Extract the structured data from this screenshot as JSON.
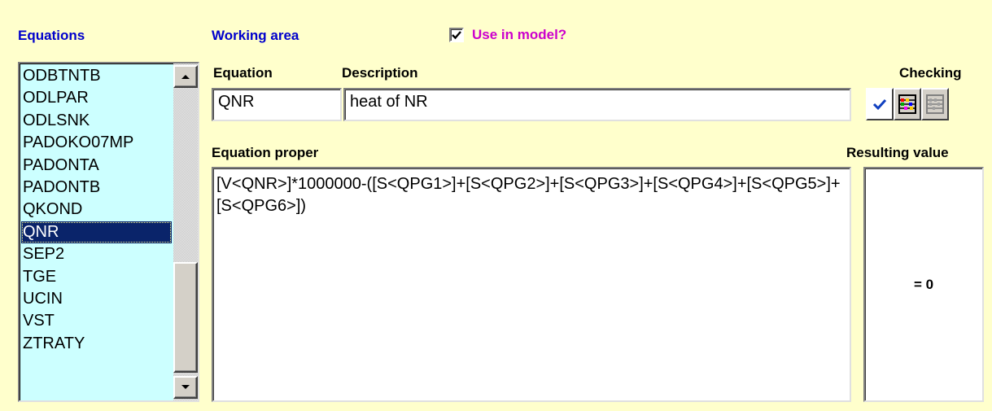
{
  "headers": {
    "equations": "Equations",
    "working_area": "Working area",
    "use_in_model": "Use in model?",
    "use_in_model_checked": true
  },
  "equation_list": {
    "items": [
      "ODBTNTB",
      "ODLPAR",
      "ODLSNK",
      "PADOKO07MP",
      "PADONTA",
      "PADONTB",
      "QKOND",
      "QNR",
      "SEP2",
      "TGE",
      "UCIN",
      "VST",
      "ZTRATY"
    ],
    "selected": "QNR"
  },
  "labels": {
    "equation": "Equation",
    "description": "Description",
    "checking": "Checking",
    "equation_proper": "Equation proper",
    "resulting_value": "Resulting value"
  },
  "fields": {
    "equation_name": "QNR",
    "description": "heat of NR",
    "equation_proper": "[V<QNR>]*1000000-([S<QPG1>]+[S<QPG2>]+[S<QPG3>]+[S<QPG4>]+[S<QPG5>]+[S<QPG6>])",
    "resulting_value": "= 0"
  },
  "checking_buttons": [
    "check-icon",
    "abacus-color-icon",
    "abacus-gray-icon"
  ],
  "colors": {
    "background": "#ffffcc",
    "header_blue": "#0000cc",
    "checkbox_label": "#cc00cc",
    "list_background": "#ccffff",
    "selection": "#0a246a"
  }
}
